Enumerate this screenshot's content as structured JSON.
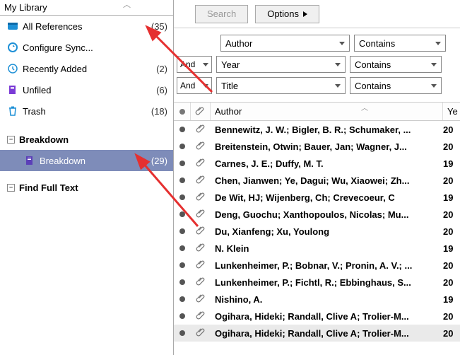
{
  "sidebar": {
    "header": "My Library",
    "items": {
      "allrefs": {
        "label": "All References",
        "count": "(35)"
      },
      "config": {
        "label": "Configure Sync...",
        "count": ""
      },
      "recent": {
        "label": "Recently Added",
        "count": "(2)"
      },
      "unfiled": {
        "label": "Unfiled",
        "count": "(6)"
      },
      "trash": {
        "label": "Trash",
        "count": "(18)"
      }
    },
    "groups": {
      "breakdown": {
        "label": "Breakdown"
      },
      "breakdown_child": {
        "label": "Breakdown",
        "count": "(29)"
      },
      "findfull": {
        "label": "Find Full Text"
      }
    }
  },
  "toolbar": {
    "search": "Search",
    "options": "Options"
  },
  "search": {
    "and": "And",
    "row1_field": "Author",
    "row1_cond": "Contains",
    "row2_field": "Year",
    "row2_cond": "Contains",
    "row3_field": "Title",
    "row3_cond": "Contains"
  },
  "table": {
    "head_author": "Author",
    "head_year": "Ye"
  },
  "refs": [
    {
      "author": "Bennewitz, J. W.; Bigler, B. R.; Schumaker, ...",
      "year": "20"
    },
    {
      "author": "Breitenstein, Otwin; Bauer, Jan; Wagner, J...",
      "year": "20"
    },
    {
      "author": "Carnes, J. E.; Duffy, M. T.",
      "year": "19"
    },
    {
      "author": "Chen, Jianwen; Ye, Dagui; Wu, Xiaowei; Zh...",
      "year": "20"
    },
    {
      "author": "De Wit, HJ; Wijenberg, Ch; Crevecoeur, C",
      "year": "19"
    },
    {
      "author": "Deng, Guochu; Xanthopoulos, Nicolas; Mu...",
      "year": "20"
    },
    {
      "author": "Du, Xianfeng; Xu, Youlong",
      "year": "20"
    },
    {
      "author": "N. Klein",
      "year": "19"
    },
    {
      "author": "Lunkenheimer, P.; Bobnar, V.; Pronin, A. V.; ...",
      "year": "20"
    },
    {
      "author": "Lunkenheimer, P.; Fichtl, R.; Ebbinghaus, S...",
      "year": "20"
    },
    {
      "author": "Nishino, A.",
      "year": "19"
    },
    {
      "author": "Ogihara, Hideki; Randall, Clive A; Trolier-M...",
      "year": "20"
    },
    {
      "author": "Ogihara, Hideki; Randall, Clive A; Trolier-M...",
      "year": "20"
    }
  ]
}
